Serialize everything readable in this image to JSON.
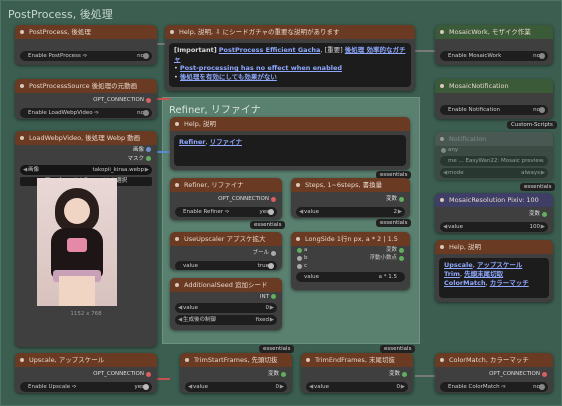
{
  "group": {
    "title": "PostProcess, 後処理"
  },
  "inner_group": {
    "title": "Refiner, リファイナ"
  },
  "nodes": {
    "postprocess": {
      "title": "PostProcess, 後処理",
      "toggle_label": "Enable PostProcess ➩",
      "toggle_value": "no"
    },
    "postprocess_source": {
      "title": "PostProcessSource 後処理の元動画",
      "output_label": "OPT_CONNECTION",
      "toggle_label": "Enable LoadWebpVideo ➩",
      "toggle_value": "no"
    },
    "load_webp": {
      "title": "LoadWebpVideo, 後処理 Webp 動画",
      "out1": "画像",
      "out2": "マスク",
      "file_label": "画像",
      "file_value": "takopii_kiraa.webp",
      "upload_label": "アップロードするファイルを選択",
      "caption": "1152 x 768"
    },
    "upscale": {
      "title": "Upscale, アップスケール",
      "output_label": "OPT_CONNECTION",
      "toggle_label": "Enable Upscale ➩",
      "toggle_value": "yes"
    },
    "help_top": {
      "title": "Help, 説明, ⇩ にシードガチャの重要な説明があります",
      "line1_prefix": "[Important]",
      "line1_link": "PostProcess Efficient Gacha",
      "line1_mid": ", [重要] ",
      "line1_link2": "後処理 効率的なガチャ",
      "bullet1": "Post-processing has no effect when enabled",
      "bullet2": "後処理を有効にしても効果がない"
    },
    "help_refiner": {
      "title": "Help, 説明",
      "link1": "Refiner",
      "sep": ", ",
      "link2": "リファイナ"
    },
    "refiner": {
      "title": "Refiner, リファイナ",
      "output_label": "OPT_CONNECTION",
      "toggle_label": "Enable Refiner ➩",
      "toggle_value": "yes"
    },
    "steps": {
      "title": "Steps, 1~6steps, 書換量",
      "out_label": "変数",
      "widget_label": "value",
      "widget_value": "2"
    },
    "use_upscaler": {
      "title": "UseUpscaler アプスケ拡大",
      "out_label": "ブール",
      "widget_label": "value",
      "widget_value": "true"
    },
    "longside": {
      "title": "LongSide 1行n px, a * 2 | 1.5",
      "in_a": "a",
      "in_b": "b",
      "in_c": "c",
      "out1": "変数",
      "out2": "浮動小数点",
      "widget_label": "value",
      "widget_value": "a * 1.5"
    },
    "additional_seed": {
      "title": "AdditionalSeed 追加シード",
      "out_label": "INT",
      "widget1_label": "value",
      "widget1_value": "0",
      "widget2_label": "生成後の制御",
      "widget2_value": "fixed"
    },
    "trim_start": {
      "title": "TrimStartFrames, 先頭切抜",
      "out_label": "変数",
      "widget_label": "value",
      "widget_value": "0"
    },
    "trim_end": {
      "title": "TrimEndFrames, 末尾切抜",
      "out_label": "変数",
      "widget_label": "value",
      "widget_value": "0"
    },
    "mosaic_work": {
      "title": "MosaicWork, モザイク作業",
      "toggle_label": "Enable MosaicWork",
      "toggle_value": "no"
    },
    "mosaic_notification": {
      "title": "MosaicNotification",
      "toggle_label": "Enable Notification",
      "toggle_value": "no"
    },
    "notification": {
      "title": "Notification",
      "in_label": "any",
      "widget1_value": "me ... EasyWan22: Mosaic preview.",
      "widget2_label": "mode",
      "widget2_value": "always"
    },
    "mosaic_resolution": {
      "title": "MosaicResolution Pixiv: 100",
      "out_label": "変数",
      "widget_label": "value",
      "widget_value": "100"
    },
    "help_right": {
      "title": "Help, 説明",
      "line1_a": "Upscale",
      "line1_b": "アップスケール",
      "line2_a": "Trim",
      "line2_b": "先頭末尾切取",
      "line3_a": "ColorMatch",
      "line3_b": "カラーマッチ"
    },
    "color_match": {
      "title": "ColorMatch, カラーマッチ",
      "output_label": "OPT_CONNECTION",
      "toggle_label": "Enable ColorMatch ➩",
      "toggle_value": "no"
    }
  },
  "badges": {
    "essentials": "essentials",
    "custom_scripts": "Custom-Scripts"
  }
}
